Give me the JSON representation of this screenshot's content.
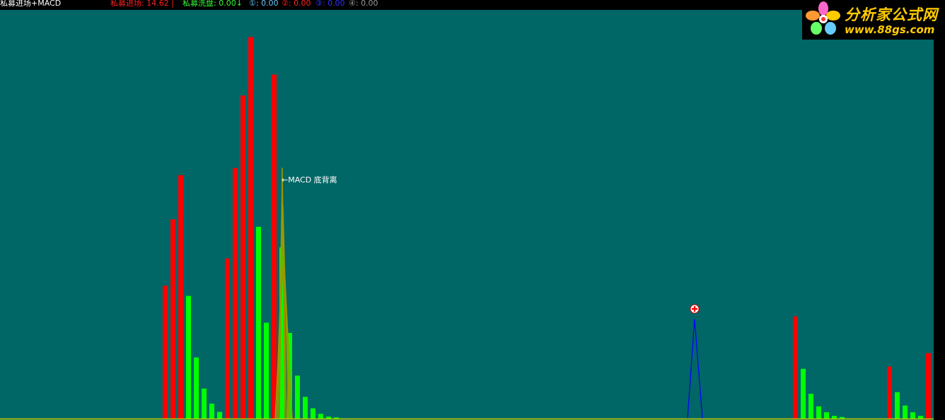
{
  "header": {
    "indicator_name": "私募进场+MACD",
    "items": [
      {
        "label": "私募进场: 14.62 |",
        "color": "#ff2020"
      },
      {
        "label": "私募洗盘: 0.00↓",
        "color": "#33ff33"
      },
      {
        "label": "①: 0.00",
        "color": "#66ccff"
      },
      {
        "label": "②: 0.00",
        "color": "#ff2020"
      },
      {
        "label": "③: 0.00",
        "color": "#3333ff"
      },
      {
        "label": "④: 0.00",
        "color": "#999999"
      }
    ]
  },
  "logo": {
    "brand": "分析家公式网",
    "url": "www.88gs.com"
  },
  "annotation": {
    "text": "←MACD 底背离"
  },
  "colors": {
    "background": "#006666",
    "red_bar": "#ff0000",
    "green_bar": "#00ff00",
    "olive_line": "#999900",
    "blue_line": "#0000ff",
    "baseline": "#cccc00"
  },
  "chart_data": {
    "type": "bar",
    "ylim": [
      0,
      100
    ],
    "red_bars": [
      {
        "x": 234,
        "value": 33.7
      },
      {
        "x": 245,
        "value": 50.5
      },
      {
        "x": 256,
        "value": 61.7
      },
      {
        "x": 322,
        "value": 40.6
      },
      {
        "x": 333,
        "value": 63.5
      },
      {
        "x": 344,
        "value": 81.9
      },
      {
        "x": 355,
        "value": 96.7
      },
      {
        "x": 388,
        "value": 87.2
      },
      {
        "x": 1125,
        "value": 25.9
      },
      {
        "x": 1258,
        "value": 13.2
      },
      {
        "x": 1313,
        "value": 16.6
      }
    ],
    "green_bars": [
      {
        "x": 267,
        "value": 31.1
      },
      {
        "x": 278,
        "value": 15.5
      },
      {
        "x": 289,
        "value": 7.6
      },
      {
        "x": 300,
        "value": 3.8
      },
      {
        "x": 311,
        "value": 1.7
      },
      {
        "x": 366,
        "value": 48.6
      },
      {
        "x": 377,
        "value": 24.3
      },
      {
        "x": 399,
        "value": 43.4
      },
      {
        "x": 410,
        "value": 21.7
      },
      {
        "x": 421,
        "value": 10.9
      },
      {
        "x": 432,
        "value": 5.5
      },
      {
        "x": 443,
        "value": 2.6
      },
      {
        "x": 454,
        "value": 1.2
      },
      {
        "x": 465,
        "value": 0.5
      },
      {
        "x": 476,
        "value": 0.3
      },
      {
        "x": 1136,
        "value": 12.6
      },
      {
        "x": 1147,
        "value": 6.3
      },
      {
        "x": 1158,
        "value": 3.1
      },
      {
        "x": 1169,
        "value": 1.6
      },
      {
        "x": 1180,
        "value": 0.7
      },
      {
        "x": 1191,
        "value": 0.4
      },
      {
        "x": 1269,
        "value": 6.7
      },
      {
        "x": 1280,
        "value": 3.3
      },
      {
        "x": 1291,
        "value": 1.6
      },
      {
        "x": 1302,
        "value": 0.7
      }
    ],
    "olive_lines": [
      {
        "x": 399,
        "value": 63.6
      },
      {
        "x": 399,
        "value": 59.0
      },
      {
        "x": 400,
        "value": 54.0
      },
      {
        "x": 400,
        "value": 48.0
      },
      {
        "x": 401,
        "value": 42.0
      }
    ],
    "blue_peak": {
      "x0": 972,
      "x_peak": 982,
      "x1": 993,
      "value": 25.2
    },
    "marker": {
      "x": 982,
      "value": 27.8
    }
  }
}
